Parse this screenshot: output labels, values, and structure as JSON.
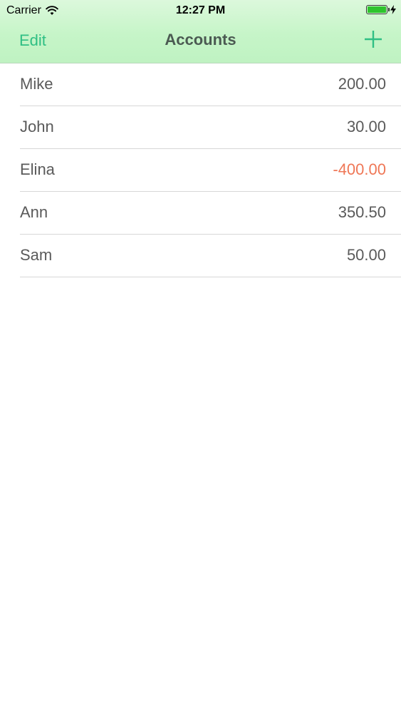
{
  "status_bar": {
    "carrier": "Carrier",
    "time": "12:27 PM",
    "battery_level": 1.0,
    "battery_color": "#2ec42e"
  },
  "nav": {
    "edit_label": "Edit",
    "title": "Accounts",
    "add_icon": "plus-icon",
    "accent_color": "#2fbf84"
  },
  "accounts": [
    {
      "name": "Mike",
      "amount": "200.00",
      "negative": false
    },
    {
      "name": "John",
      "amount": "30.00",
      "negative": false
    },
    {
      "name": "Elina",
      "amount": "-400.00",
      "negative": true
    },
    {
      "name": "Ann",
      "amount": "350.50",
      "negative": false
    },
    {
      "name": "Sam",
      "amount": "50.00",
      "negative": false
    }
  ],
  "colors": {
    "negative_amount": "#ef7756",
    "text": "#5a5a5a"
  }
}
